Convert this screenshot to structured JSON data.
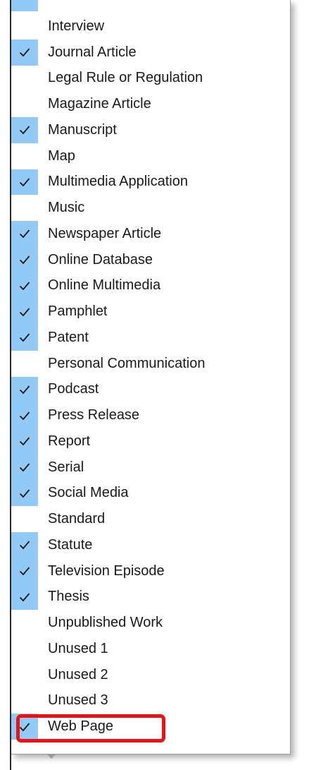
{
  "menu": {
    "items": [
      {
        "label": "Interview",
        "checked": false
      },
      {
        "label": "Journal Article",
        "checked": true
      },
      {
        "label": "Legal Rule or Regulation",
        "checked": false
      },
      {
        "label": "Magazine Article",
        "checked": false
      },
      {
        "label": "Manuscript",
        "checked": true
      },
      {
        "label": "Map",
        "checked": false
      },
      {
        "label": "Multimedia Application",
        "checked": true
      },
      {
        "label": "Music",
        "checked": false
      },
      {
        "label": "Newspaper Article",
        "checked": true
      },
      {
        "label": "Online Database",
        "checked": true
      },
      {
        "label": "Online Multimedia",
        "checked": true
      },
      {
        "label": "Pamphlet",
        "checked": true
      },
      {
        "label": "Patent",
        "checked": true
      },
      {
        "label": "Personal Communication",
        "checked": false
      },
      {
        "label": "Podcast",
        "checked": true
      },
      {
        "label": "Press Release",
        "checked": true
      },
      {
        "label": "Report",
        "checked": true
      },
      {
        "label": "Serial",
        "checked": true
      },
      {
        "label": "Social Media",
        "checked": true
      },
      {
        "label": "Standard",
        "checked": false
      },
      {
        "label": "Statute",
        "checked": true
      },
      {
        "label": "Television Episode",
        "checked": true
      },
      {
        "label": "Thesis",
        "checked": true
      },
      {
        "label": "Unpublished Work",
        "checked": false
      },
      {
        "label": "Unused 1",
        "checked": false
      },
      {
        "label": "Unused 2",
        "checked": false
      },
      {
        "label": "Unused 3",
        "checked": false
      },
      {
        "label": "Web Page",
        "checked": true
      }
    ],
    "highlighted_item": "Web Page"
  },
  "colors": {
    "check_background": "#91c9f7",
    "checkmark": "#1a1a1a",
    "highlight_border": "#ee1111"
  },
  "icons": {
    "checkmark": "checkmark-icon",
    "scroll_down": "scroll-down-arrow-icon"
  }
}
